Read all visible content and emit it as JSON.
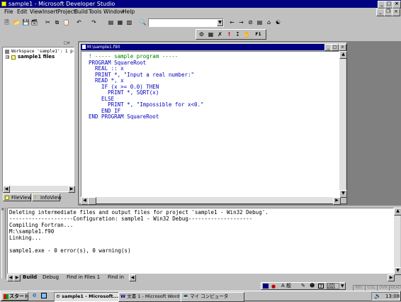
{
  "window": {
    "title": "sample1 - Microsoft Developer Studio"
  },
  "menu": [
    "File",
    "Edit",
    "View",
    "Insert",
    "Project",
    "Build",
    "Tools",
    "Window",
    "Help"
  ],
  "workspace": {
    "header": "Workspace 'sample1': 1 proje",
    "item": "sample1 files",
    "tabs": [
      "FileView",
      "InfoView"
    ]
  },
  "editor": {
    "title": "M:\\sample1.f90",
    "lines": [
      "! ----- sample program -----",
      "PROGRAM SquareRoot",
      "  REAL :: x",
      "  PRINT *, \"Input a real number:\"",
      "  READ *, x",
      "    IF (x >= 0.0) THEN",
      "      PRINT *, SQRT(x)",
      "    ELSE",
      "      PRINT *, \"Impossible for x<0.\"",
      "    END IF",
      "END PROGRAM SquareRoot"
    ],
    "line_colors": [
      "#008000",
      "#0000c0",
      "#0000c0",
      "#0000c0",
      "#0000c0",
      "#0000c0",
      "#0000c0",
      "#0000c0",
      "#0000c0",
      "#0000c0",
      "#0000c0"
    ]
  },
  "output": {
    "lines": [
      "Deleting intermediate files and output files for project 'sample1 - Win32 Debug'.",
      "--------------------Configuration: sample1 - Win32 Debug--------------------",
      "Compiling Fortran...",
      "M:\\sample1.f90",
      "Linking...",
      "",
      "sample1.exe - 0 error(s), 0 warning(s)"
    ],
    "tabs": [
      "Build",
      "Debug",
      "Find in Files 1",
      "Find in"
    ]
  },
  "statusbar": {
    "indicators": [
      "REC",
      "COL",
      "OVR",
      "READ"
    ]
  },
  "taskbar": {
    "start": "スタート",
    "tasks": [
      "sample1 - Microsoft...",
      "文書 1 - Microsoft Word",
      "マイ コンピュータ"
    ],
    "clock": "13:08",
    "ime": "A 般"
  },
  "colors": {
    "titlebar": "#000080",
    "desktop": "#808080",
    "face": "#c0c0c0"
  }
}
